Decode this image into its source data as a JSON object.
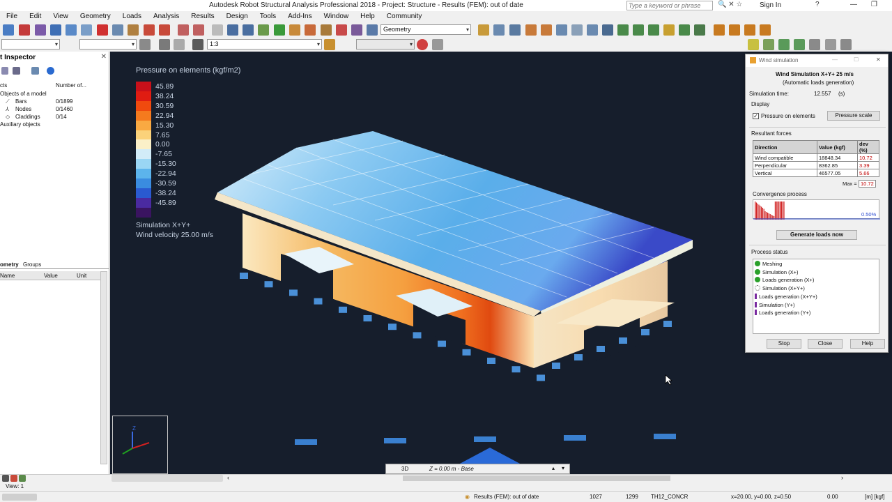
{
  "window": {
    "title": "Autodesk Robot Structural Analysis Professional 2018 - Project: Structure - Results (FEM): out of date",
    "search_placeholder": "Type a keyword or phrase",
    "sign_in": "Sign In"
  },
  "menu": [
    "File",
    "Edit",
    "View",
    "Geometry",
    "Loads",
    "Analysis",
    "Results",
    "Design",
    "Tools",
    "Add-Ins",
    "Window",
    "Help",
    "Community"
  ],
  "toolbar": {
    "layout_combo": "Geometry",
    "case_combo": "1:3"
  },
  "inspector": {
    "title": "t Inspector",
    "col_objects": "cts",
    "col_number": "Number of...",
    "root": "Objects of a model",
    "items": [
      {
        "label": "Bars",
        "count": "0/1899"
      },
      {
        "label": "Nodes",
        "count": "0/1460"
      },
      {
        "label": "Claddings",
        "count": "0/14"
      }
    ],
    "aux": "Auxiliary objects",
    "tabs": [
      "ometry",
      "Groups"
    ],
    "prop_cols": [
      "Name",
      "Value",
      "Unit"
    ]
  },
  "legend": {
    "title": "Pressure on elements (kgf/m2)",
    "items": [
      {
        "value": "45.89",
        "color": "#c8101a"
      },
      {
        "value": "38.24",
        "color": "#e01c12"
      },
      {
        "value": "30.59",
        "color": "#f04a0e"
      },
      {
        "value": "22.94",
        "color": "#f57a1e"
      },
      {
        "value": "15.30",
        "color": "#f9a942"
      },
      {
        "value": "7.65",
        "color": "#fbd27a"
      },
      {
        "value": "0.00",
        "color": "#fbf0c8"
      },
      {
        "value": "-7.65",
        "color": "#d2ecf8"
      },
      {
        "value": "-15.30",
        "color": "#9ad6f4"
      },
      {
        "value": "-22.94",
        "color": "#5cb4ec"
      },
      {
        "value": "-30.59",
        "color": "#3a8ce0"
      },
      {
        "value": "-38.24",
        "color": "#2a5ad0"
      },
      {
        "value": "-45.89",
        "color": "#4a2aa0"
      },
      {
        "value": "",
        "color": "#3a1460"
      }
    ],
    "sim_line1": "Simulation X+Y+",
    "sim_line2": "Wind velocity 25.00 m/s"
  },
  "wind_dialog": {
    "title": "Wind simulation",
    "heading": "Wind Simulation X+Y+ 25 m/s",
    "subheading": "(Automatic loads generation)",
    "sim_time_label": "Simulation time:",
    "sim_time_value": "12.557",
    "sim_time_unit": "(s)",
    "display_label": "Display",
    "pressure_checkbox": "Pressure on elements",
    "pressure_scale_btn": "Pressure scale",
    "resultant_label": "Resultant forces",
    "table_headers": [
      "Direction",
      "Value (kgf)",
      "dev (%)"
    ],
    "table_rows": [
      {
        "direction": "Wind compatible",
        "value": "18848.34",
        "dev": "10.72"
      },
      {
        "direction": "Perpendicular",
        "value": "8362.85",
        "dev": "3.39"
      },
      {
        "direction": "Vertical",
        "value": "46577.05",
        "dev": "5.66"
      }
    ],
    "max_label": "Max =",
    "max_value": "10.72",
    "convergence_label": "Convergence process",
    "convergence_value": "0.50%",
    "generate_btn": "Generate loads now",
    "status_label": "Process status",
    "status_items": [
      {
        "label": "Meshing",
        "state": "done"
      },
      {
        "label": "Simulation (X+)",
        "state": "done"
      },
      {
        "label": "Loads generation (X+)",
        "state": "done"
      },
      {
        "label": "Simulation (X+Y+)",
        "state": "running"
      },
      {
        "label": "Loads generation (X+Y+)",
        "state": "pending"
      },
      {
        "label": "Simulation (Y+)",
        "state": "pending"
      },
      {
        "label": "Loads generation (Y+)",
        "state": "pending"
      }
    ],
    "stop_btn": "Stop",
    "close_btn": "Close",
    "help_btn": "Help"
  },
  "viewbar": {
    "mode": "3D",
    "level": "Z = 0.00 m - Base"
  },
  "statusbar": {
    "view": "View: 1",
    "results": "Results (FEM): out of date",
    "num1": "1027",
    "num2": "1299",
    "section": "TH12_CONCR",
    "coords": "x=20.00, y=0.00, z=0.50",
    "angle": "0.00",
    "units": "[m] [kgf]"
  }
}
